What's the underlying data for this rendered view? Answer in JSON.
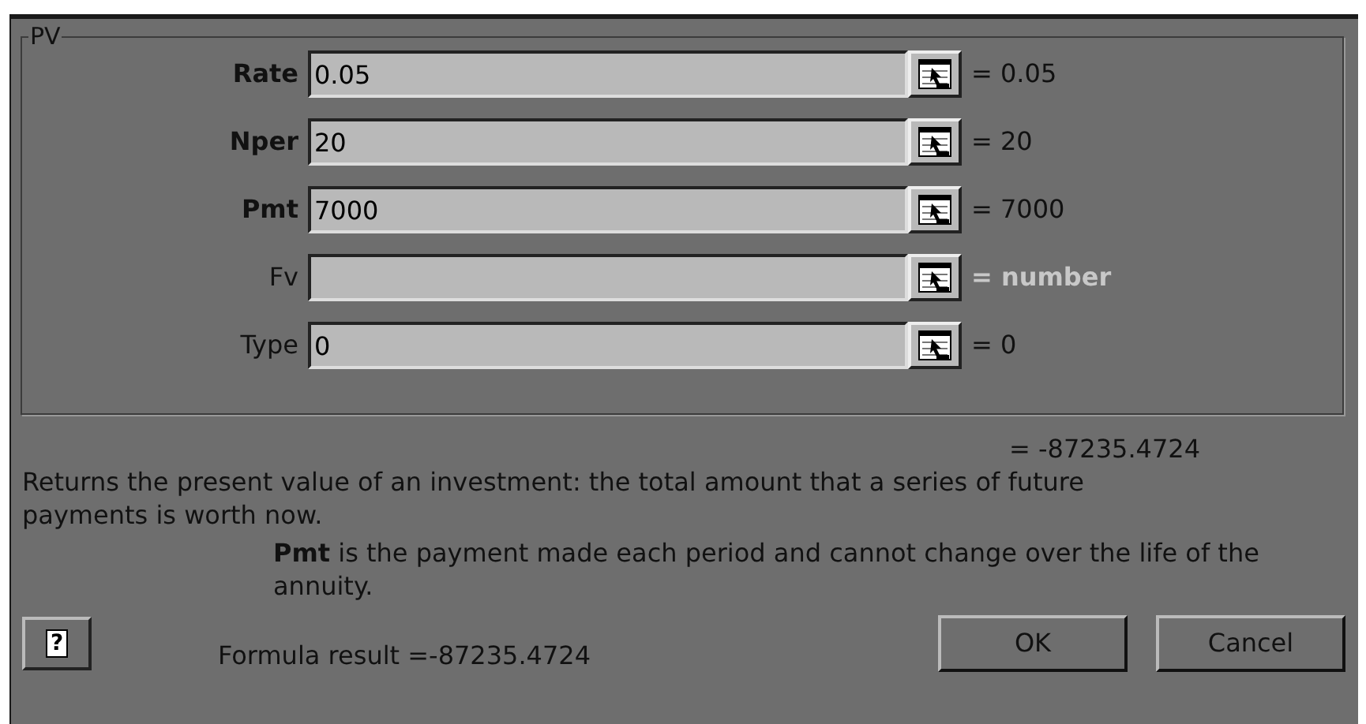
{
  "group_title": "PV",
  "arguments": [
    {
      "label": "Rate",
      "required": true,
      "value": "0.05",
      "result": "= 0.05",
      "result_muted": false
    },
    {
      "label": "Nper",
      "required": true,
      "value": "20",
      "result": "= 20",
      "result_muted": false
    },
    {
      "label": "Pmt",
      "required": true,
      "value": "7000",
      "result": "= 7000",
      "result_muted": false
    },
    {
      "label": "Fv",
      "required": false,
      "result": "= number",
      "result_muted": true
    },
    {
      "label": "Type",
      "required": false,
      "value": "0",
      "result": "= 0",
      "result_muted": false
    }
  ],
  "function_result": "= -87235.4724",
  "description": "Returns the present value of an investment: the total amount that a series of future payments is worth now.",
  "argument_help": "**Pmt** is the payment made each period and cannot change over the life of the annuity.",
  "help_button": "?",
  "formula_result": "Formula result =-87235.4724",
  "buttons": [
    "OK",
    "Cancel"
  ]
}
